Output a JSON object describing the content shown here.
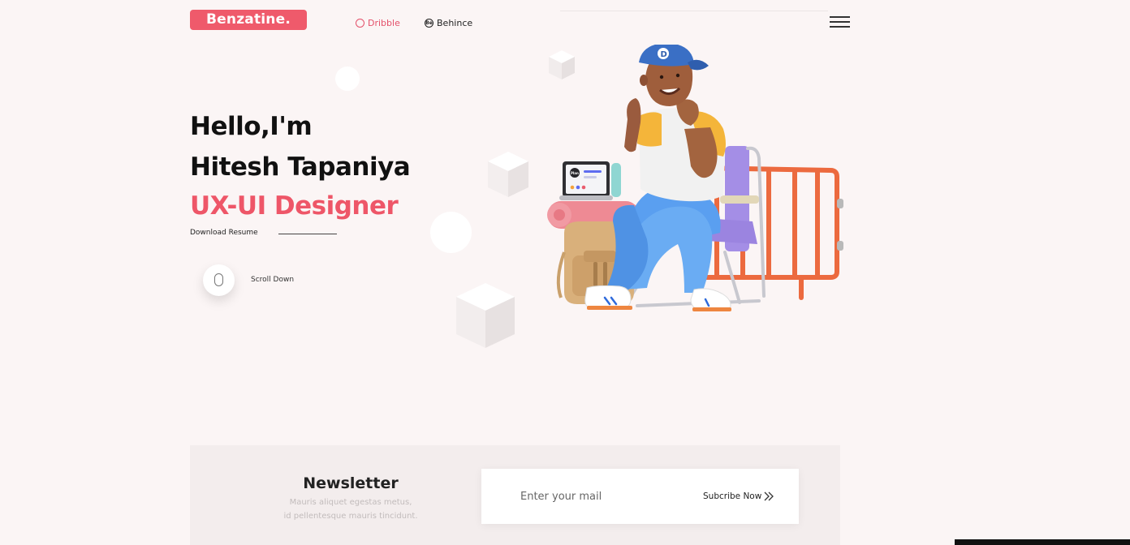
{
  "header": {
    "logo": "Benzatine.",
    "nav": [
      {
        "label": "Dribble",
        "icon": "dribbble-icon"
      },
      {
        "label": "Behince",
        "icon": "behance-icon"
      }
    ],
    "behance_icon_glyph": "Be",
    "menu_icon": "hamburger-menu-icon"
  },
  "hero": {
    "line1": "Hello,I'm",
    "line2": "Hitesh Tapaniya",
    "line3": "UX-UI Designer",
    "resume_label": "Download Resume",
    "scroll_label": "Scroll Down"
  },
  "illustration": {
    "cap_letter": "D",
    "laptop_label": "Plan"
  },
  "newsletter": {
    "title": "Newsletter",
    "desc_line1": "Mauris aliquet egestas metus,",
    "desc_line2": "id pellentesque mauris tincidunt.",
    "input_placeholder": "Enter your mail",
    "button_label": "Subcribe Now",
    "button_icon": "double-chevron-right-icon"
  },
  "colors": {
    "accent": "#ef5a6b",
    "background": "#fbf5f5",
    "text": "#111111"
  }
}
